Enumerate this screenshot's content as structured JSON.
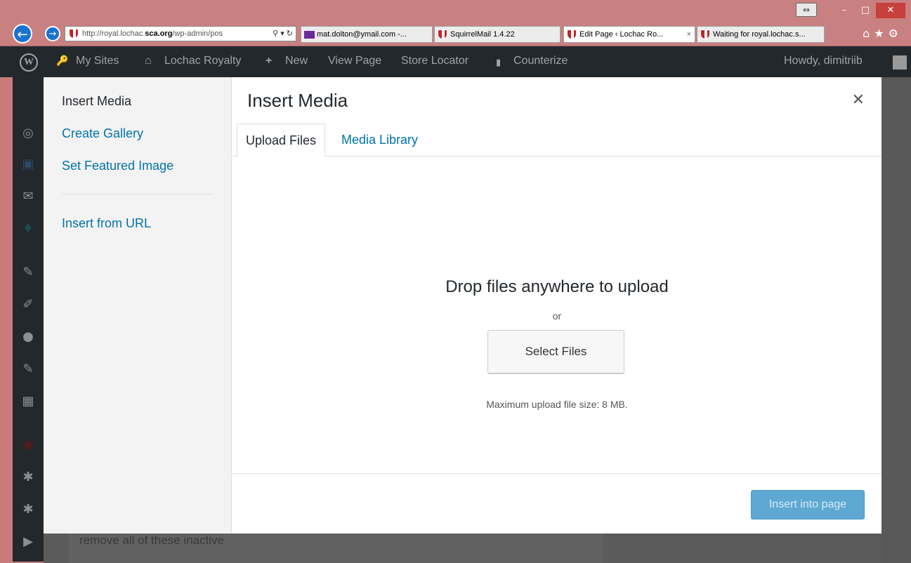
{
  "browser": {
    "address_prefix": "http://royal.lochac.",
    "address_bold": "sca.org",
    "address_suffix": "/wp-admin/pos",
    "address_tools": "⚲ ▾ ↻",
    "tabs": [
      {
        "label": "mat.dolton@ymail.com -..."
      },
      {
        "label": "SquirrelMail 1.4.22"
      },
      {
        "label": "Edit Page ‹ Lochac Ro..."
      },
      {
        "label": "Waiting for royal.lochac.s..."
      }
    ],
    "tab_close": "×",
    "right_icons": "⌂★⚙",
    "window_controls": {
      "restore": "⇔",
      "minimize": "–",
      "maximize": "□",
      "close": "✕"
    }
  },
  "adminbar": {
    "wp_logo": "W",
    "my_sites": "My Sites",
    "site_name": "Lochac Royalty",
    "new": "New",
    "view_page": "View Page",
    "store_locator": "Store Locator",
    "counterize": "Counterize",
    "howdy": "Howdy, dimitriib",
    "icons": {
      "my_sites": "🔑",
      "site": "⌂",
      "new": "+",
      "counterize": "▮"
    }
  },
  "background": {
    "text": "remove all of these inactive"
  },
  "modal": {
    "title": "Insert Media",
    "close_icon": "✕",
    "sidebar": {
      "heading": "Insert Media",
      "links": [
        "Create Gallery",
        "Set Featured Image",
        "Insert from URL"
      ]
    },
    "tabs": [
      "Upload Files",
      "Media Library"
    ],
    "drop_title": "Drop files anywhere to upload",
    "or": "or",
    "select_files": "Select Files",
    "max_size": "Maximum upload file size: 8 MB.",
    "insert_button": "Insert into page"
  }
}
